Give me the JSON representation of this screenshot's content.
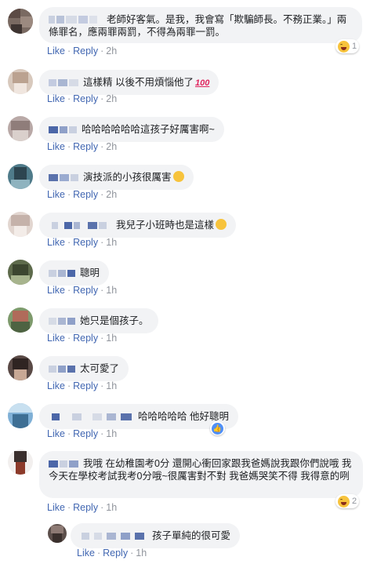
{
  "labels": {
    "like": "Like",
    "reply": "Reply",
    "sep": "·"
  },
  "colors": {
    "link": "#4267b2",
    "muted": "#90949c",
    "bubble": "#f2f3f5"
  },
  "comments": [
    {
      "text": "老師好客氣。是我，我會寫「欺騙師長。不務正業。」兩條罪名，應兩罪兩罰，不得為兩罪一罰。",
      "time": "2h",
      "reaction_icon": "laugh-emoji-icon",
      "reaction_count": "1"
    },
    {
      "text": "這樣精 以後不用煩惱他了",
      "time": "2h",
      "emoji": "hundred-points-icon"
    },
    {
      "text": "哈哈哈哈哈哈這孩子好厲害啊~",
      "time": "2h"
    },
    {
      "text": "演技派的小孩很厲害",
      "time": "2h",
      "emoji": "star-struck-emoji-icon"
    },
    {
      "text": "我兒子小班時也是這樣",
      "time": "1h",
      "emoji": "rofl-emoji-icon"
    },
    {
      "text": "聰明",
      "time": "1h"
    },
    {
      "text": "她只是個孩子。",
      "time": "1h"
    },
    {
      "text": "太可愛了",
      "time": "1h"
    },
    {
      "text": "哈哈哈哈哈 他好聰明",
      "time": "1h",
      "reaction_icon": "like-icon",
      "reaction_count": ""
    },
    {
      "text": "我哦 在幼稚園考0分 還開心衝回家跟我爸媽說我跟你們說哦 我今天在學校考試我考0分哦~很厲害對不對 我爸媽哭笑不得 我得意的咧",
      "time": "1h",
      "reaction_icon": "laugh-emoji-icon",
      "reaction_count": "2"
    },
    {
      "text": "孩子單純的很可愛",
      "time": "1h",
      "is_reply": true
    }
  ]
}
